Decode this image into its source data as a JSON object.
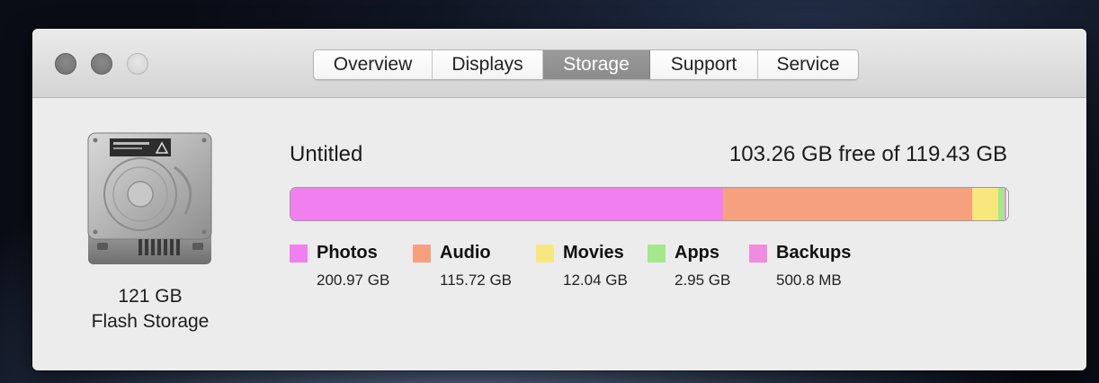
{
  "tabs": [
    {
      "label": "Overview",
      "selected": false
    },
    {
      "label": "Displays",
      "selected": false
    },
    {
      "label": "Storage",
      "selected": true
    },
    {
      "label": "Support",
      "selected": false
    },
    {
      "label": "Service",
      "selected": false
    }
  ],
  "drive": {
    "capacity": "121 GB",
    "type": "Flash Storage",
    "icon": "hard-drive-icon"
  },
  "volume": {
    "name": "Untitled",
    "free_text": "103.26 GB free of 119.43 GB"
  },
  "categories": [
    {
      "label": "Photos",
      "size": "200.97 GB",
      "color": "#f27ff0",
      "share": 0.603
    },
    {
      "label": "Audio",
      "size": "115.72 GB",
      "color": "#f7a07e",
      "share": 0.347
    },
    {
      "label": "Movies",
      "size": "12.04 GB",
      "color": "#f7e77f",
      "share": 0.036
    },
    {
      "label": "Apps",
      "size": "2.95 GB",
      "color": "#a3e88a",
      "share": 0.009
    },
    {
      "label": "Backups",
      "size": "500.8 MB",
      "color": "#f08be0",
      "share": 0.002
    }
  ]
}
